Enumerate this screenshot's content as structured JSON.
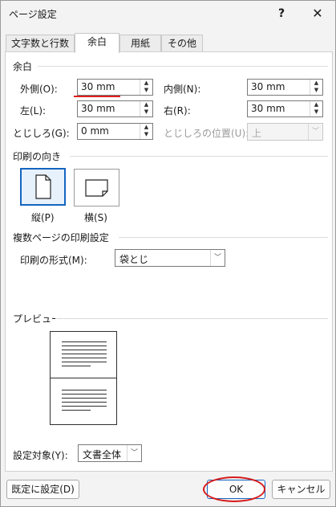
{
  "window": {
    "title": "ページ設定",
    "help": "?",
    "close": "✕"
  },
  "tabs": [
    "文字数と行数",
    "余白",
    "用紙",
    "その他"
  ],
  "margins": {
    "section_title": "余白",
    "outer_label": "外側(O):",
    "outer_value": "30 mm",
    "inner_label": "内側(N):",
    "inner_value": "30 mm",
    "left_label": "左(L):",
    "left_value": "30 mm",
    "right_label": "右(R):",
    "right_value": "30 mm",
    "gutter_label": "とじしろ(G):",
    "gutter_value": "0 mm",
    "gutter_pos_label": "とじしろの位置(U):",
    "gutter_pos_value": "上"
  },
  "orientation": {
    "section_title": "印刷の向き",
    "portrait_label": "縦(P)",
    "landscape_label": "横(S)",
    "selected": "portrait"
  },
  "multiple_pages": {
    "section_title": "複数ページの印刷設定",
    "format_label": "印刷の形式(M):",
    "format_value": "袋とじ"
  },
  "preview": {
    "section_title": "プレビュー"
  },
  "apply_to": {
    "label": "設定対象(Y):",
    "value": "文書全体"
  },
  "buttons": {
    "default": "既定に設定(D)",
    "ok": "OK",
    "cancel": "キャンセル"
  },
  "colors": {
    "annotation_red": "#e02020",
    "selection_blue": "#1565c0"
  }
}
